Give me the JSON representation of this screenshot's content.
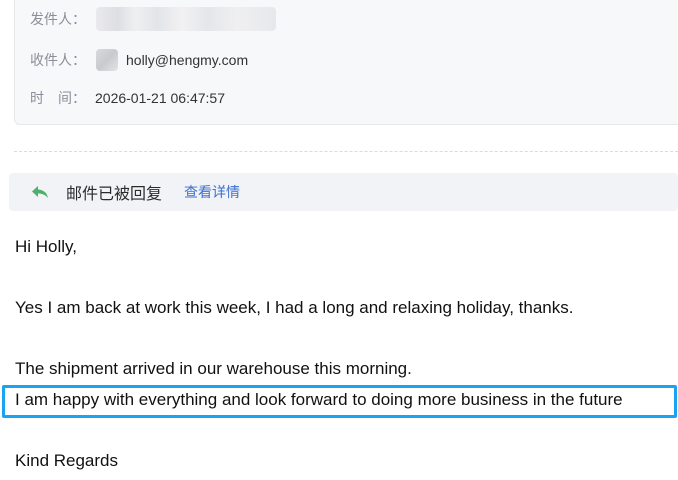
{
  "header": {
    "from_label": "发件人：",
    "to_label": "收件人：",
    "time_label": "时　间：",
    "to_value": "holly@hengmy.com",
    "time_value": "2026-01-21 06:47:57"
  },
  "reply_bar": {
    "status_text": "邮件已被回复",
    "details_link": "查看详情",
    "icon": "reply-arrow-icon",
    "icon_color": "#4caf6a"
  },
  "body": {
    "greeting": "Hi Holly,",
    "paragraph1": "Yes I am back at work this week, I had a long and relaxing holiday, thanks.",
    "paragraph2": "The shipment arrived in our warehouse this morning.",
    "paragraph3": "I am happy with everything and look forward to doing more business in the future",
    "closing": "Kind Regards"
  },
  "highlight_color": "#1aa3f0"
}
